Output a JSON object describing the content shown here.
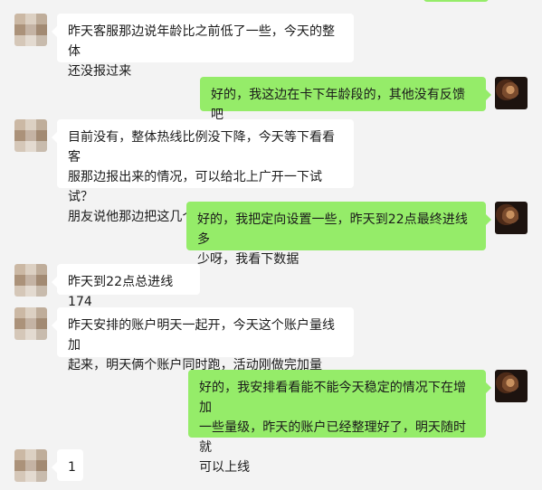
{
  "colors": {
    "background": "#f3f3f3",
    "incoming_bubble": "#ffffff",
    "outgoing_bubble": "#95ec69"
  },
  "messages": [
    {
      "direction": "incoming",
      "avatar_icon": "blurred-avatar-icon",
      "text": "昨天客服那边说年龄比之前低了一些，今天的整体\n还没报过来"
    },
    {
      "direction": "outgoing",
      "avatar_icon": "user-avatar-icon",
      "text": "好的，我这边在卡下年龄段的，其他没有反馈吧"
    },
    {
      "direction": "incoming",
      "avatar_icon": "blurred-avatar-icon",
      "text": "目前没有，整体热线比例没下降，今天等下看看客\n服那边报出来的情况，可以给北上广开一下试试？\n朋友说他那边把这几个地区都加上了"
    },
    {
      "direction": "outgoing",
      "avatar_icon": "user-avatar-icon",
      "text": "好的，我把定向设置一些，昨天到22点最终进线多\n少呀，我看下数据"
    },
    {
      "direction": "incoming",
      "avatar_icon": "blurred-avatar-icon",
      "text": "昨天到22点总进线174"
    },
    {
      "direction": "incoming",
      "avatar_icon": "blurred-avatar-icon",
      "text": "昨天安排的账户明天一起开，今天这个账户量线加\n起来，明天俩个账户同时跑，活动刚做完加量"
    },
    {
      "direction": "outgoing",
      "avatar_icon": "user-avatar-icon",
      "text": "好的，我安排看看能不能今天稳定的情况下在增加\n一些量级，昨天的账户已经整理好了，明天随时就\n可以上线"
    },
    {
      "direction": "incoming",
      "avatar_icon": "blurred-avatar-icon",
      "text": "1"
    }
  ]
}
